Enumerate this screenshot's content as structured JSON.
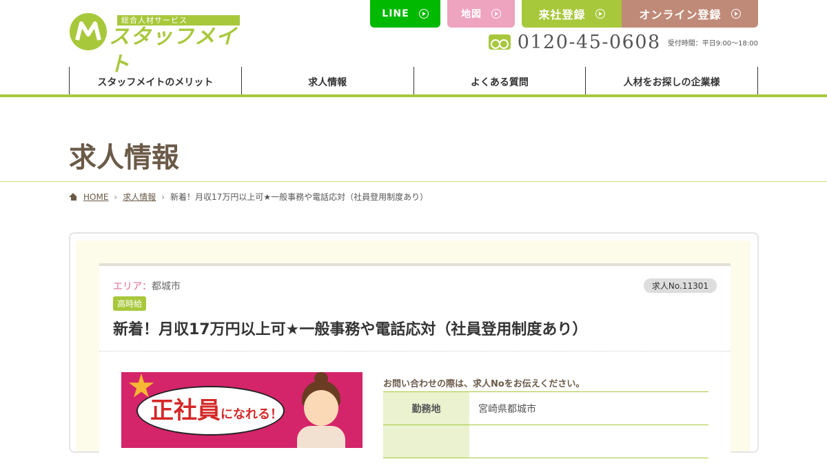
{
  "colors": {
    "brand_green": "#a8c83c",
    "line_green": "#00b900",
    "map_pink": "#eea3bf",
    "online_brown": "#c08a78",
    "title_brown": "#6b5a48",
    "area_pink": "#e36c99"
  },
  "logo": {
    "sub": "総合人材サービス",
    "main": "スタッフメイト"
  },
  "top_buttons": {
    "line": "LINE",
    "map": "地図",
    "visit": "来社登録",
    "online": "オンライン登録"
  },
  "phone": {
    "number": "0120-45-0608",
    "hours": "受付時間：平日9:00～18:00"
  },
  "nav": {
    "items": [
      {
        "label": "スタッフメイトのメリット"
      },
      {
        "label": "求人情報"
      },
      {
        "label": "よくある質問"
      },
      {
        "label": "人材をお探しの企業様"
      }
    ]
  },
  "page": {
    "title": "求人情報"
  },
  "breadcrumb": {
    "home": "HOME",
    "jobs": "求人情報",
    "current": "新着！月収17万円以上可★一般事務や電話応対（社員登用制度あり）"
  },
  "job": {
    "area_label": "エリア：",
    "area_value": "都城市",
    "job_no": "求人No.11301",
    "tag": "高時給",
    "title": "新着！月収17万円以上可★一般事務や電話応対（社員登用制度あり）",
    "image_text_big": "正社員",
    "image_text_small": "になれる！",
    "inquiry_note": "お問い合わせの際は、求人Noをお伝えください。",
    "table": [
      {
        "th": "勤務地",
        "td": "宮崎県都城市"
      },
      {
        "th": "",
        "td": ""
      }
    ]
  }
}
